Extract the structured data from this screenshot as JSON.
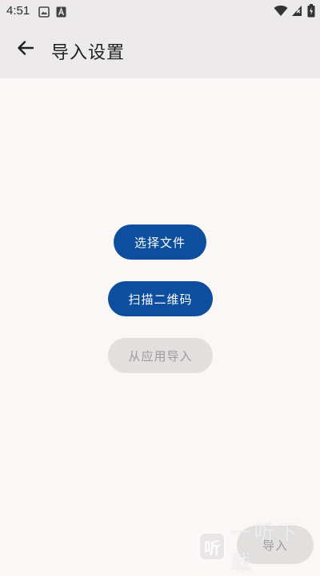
{
  "status_bar": {
    "time": "4:51",
    "icons_left": [
      "image-icon",
      "a-letter-icon"
    ],
    "icons_right": [
      "wifi-icon",
      "no-sim-icon",
      "battery-icon"
    ]
  },
  "app_bar": {
    "title": "导入设置",
    "back_icon": "back-arrow-icon"
  },
  "actions": {
    "choose_file": "选择文件",
    "scan_qr": "扫描二维码",
    "import_from_app": "从应用导入"
  },
  "bottom": {
    "import_label": "导入"
  },
  "watermark": {
    "logo_char": "听",
    "text": "一听下载"
  },
  "colors": {
    "primary": "#0d4e9e",
    "background": "#fbf7f6",
    "bar": "#eceaea",
    "disabled_bg": "#e2e0df",
    "disabled_text": "#9c9a9a"
  }
}
